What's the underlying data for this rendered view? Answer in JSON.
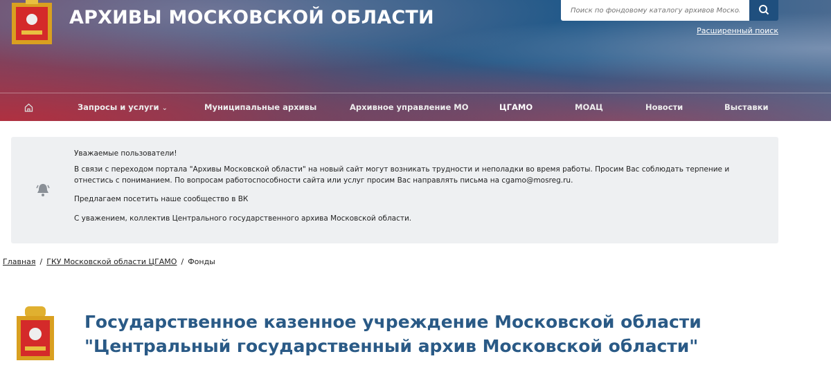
{
  "header": {
    "title": "АРХИВЫ МОСКОВСКОЙ ОБЛАСТИ",
    "search_placeholder": "Поиск по фондовому каталогу архивов Московско",
    "advanced_search": "Расширенный поиск"
  },
  "nav": {
    "items": [
      {
        "label": "Запросы и услуги"
      },
      {
        "label": "Муниципальные архивы"
      },
      {
        "label": "Архивное управление МО"
      },
      {
        "label": "ЦГАМО"
      },
      {
        "label": "МОАЦ"
      },
      {
        "label": "Новости"
      },
      {
        "label": "Выставки"
      }
    ]
  },
  "notice": {
    "greeting": "Уважаемые пользователи!",
    "body": "В связи с переходом портала \"Архивы Московской области\" на новый сайт могут возникать трудности и неполадки во время работы. Просим Вас соблюдать терпение и отнестись с пониманием. По вопросам работоспособности сайта или услуг просим Вас направлять письма на cgamo@mosreg.ru.",
    "vk": "Предлагаем посетить наше сообщество в ВК",
    "signature": "С уважением, коллектив Центрального государственного архива Московской области."
  },
  "breadcrumb": {
    "items": [
      "Главная",
      "ГКУ Московской области ЦГАМО",
      "Фонды"
    ]
  },
  "org": {
    "title_line1": "Государственное казенное учреждение Московской области",
    "title_line2": "\"Центральный государственный архив Московской области\""
  },
  "colors": {
    "title": "#2a5a86",
    "search_button": "#1f4f7e",
    "notice_bg": "#eef0f2"
  }
}
